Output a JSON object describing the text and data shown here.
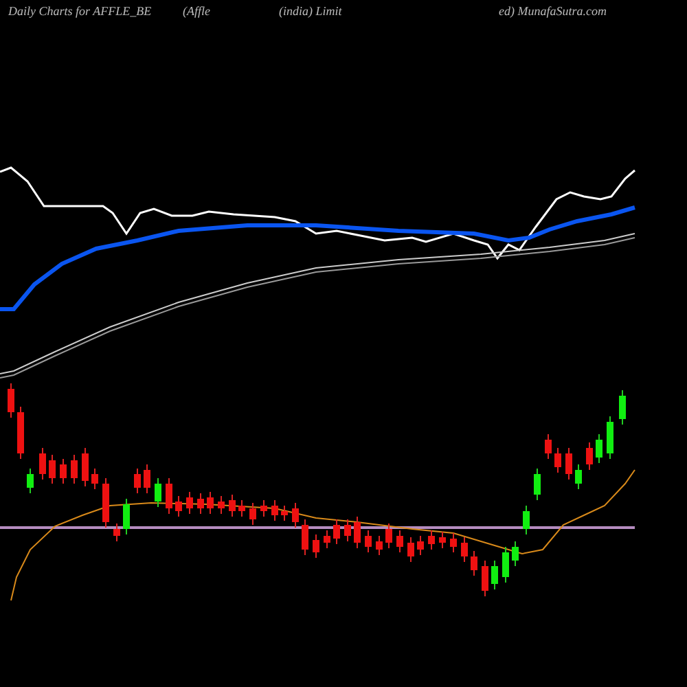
{
  "header": {
    "texts": [
      "Daily Charts for AFFLE_BE",
      "(Affle",
      "(india) Limit",
      "ed) MunafaSutra.com"
    ]
  }
}
